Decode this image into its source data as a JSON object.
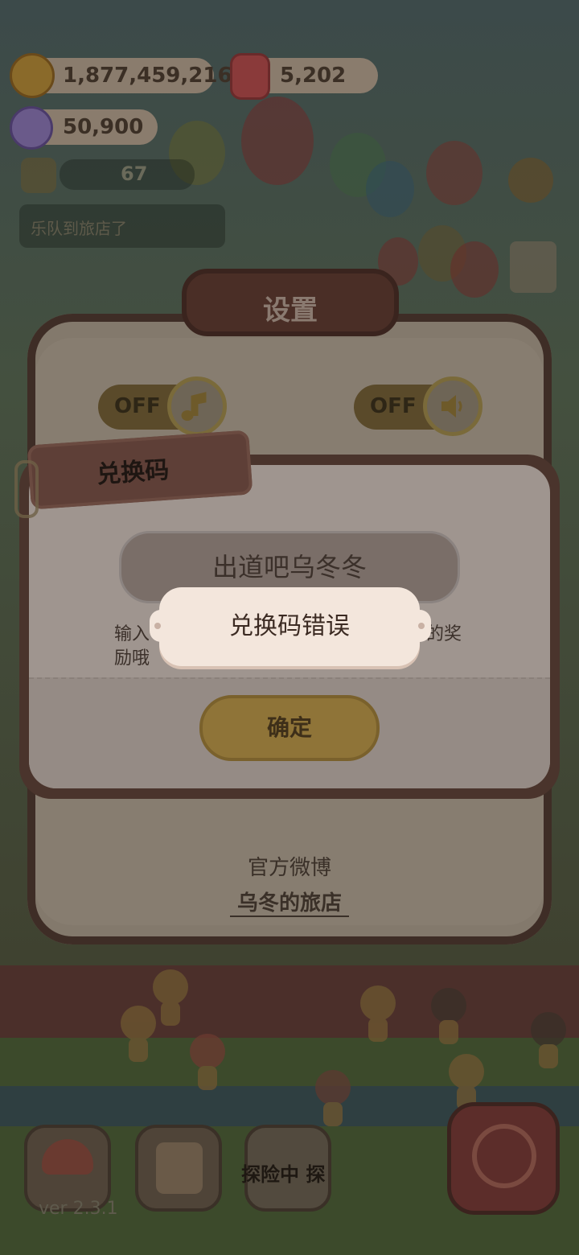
{
  "hud": {
    "coins": "1,877,459,216",
    "gems": "5,202",
    "candy": "50,900",
    "level": "67",
    "news": "乐队到旅店了"
  },
  "settings": {
    "title": "设置",
    "music_toggle": "OFF",
    "sound_toggle": "OFF",
    "weibo_label": "官方微博",
    "weibo_account": "乌冬的旅店"
  },
  "redeem": {
    "title": "兑换码",
    "code_value": "出道吧乌冬冬",
    "hint_left": "输入",
    "hint_right": "的奖",
    "hint_line2": "励哦",
    "confirm": "确定"
  },
  "toast": {
    "message": "兑换码错误"
  },
  "bottom": {
    "adventure_label": "探险中 探",
    "version": "ver 2.3.1"
  }
}
